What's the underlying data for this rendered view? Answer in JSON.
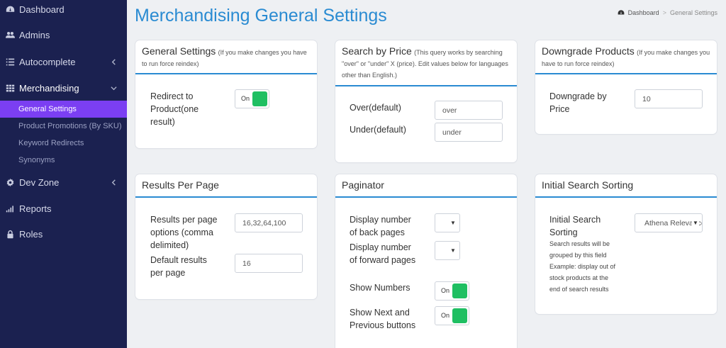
{
  "sidebar": {
    "items": [
      {
        "label": "Dashboard",
        "icon": "dashboard-icon"
      },
      {
        "label": "Admins",
        "icon": "users-icon"
      },
      {
        "label": "Autocomplete",
        "icon": "list-icon"
      },
      {
        "label": "Merchandising",
        "icon": "grid-icon"
      },
      {
        "label": "Dev Zone",
        "icon": "gear-icon"
      },
      {
        "label": "Reports",
        "icon": "bar-chart-icon"
      },
      {
        "label": "Roles",
        "icon": "lock-icon"
      }
    ],
    "sub_items": [
      {
        "label": "General Settings"
      },
      {
        "label": "Product Promotions (By SKU)"
      },
      {
        "label": "Keyword Redirects"
      },
      {
        "label": "Synonyms"
      }
    ]
  },
  "header": {
    "title": "Merchandising General Settings",
    "breadcrumb": {
      "home": "Dashboard",
      "separator": ">",
      "current": "General Settings"
    }
  },
  "cards": {
    "general": {
      "title": "General Settings",
      "note": "(If you make changes you have to run force reindex)",
      "redirect_label": "Redirect to Product(one result)",
      "redirect_toggle": "On"
    },
    "search_price": {
      "title": "Search by Price",
      "note": "(This query works by searching \"over\" or \"under\" X (price). Edit values below for languages other than English.)",
      "over_label": "Over(default)",
      "over_value": "over",
      "under_label": "Under(default)",
      "under_value": "under"
    },
    "downgrade": {
      "title": "Downgrade Products",
      "note": "(If you make changes you have to run force reindex)",
      "price_label": "Downgrade by Price",
      "price_value": "10"
    },
    "results": {
      "title": "Results Per Page",
      "options_label": "Results per page options (comma delimited)",
      "options_value": "16,32,64,100",
      "default_label": "Default results per page",
      "default_value": "16"
    },
    "paginator": {
      "title": "Paginator",
      "back_label": "Display number of back pages",
      "forward_label": "Display number of forward pages",
      "numbers_label": "Show Numbers",
      "numbers_toggle": "On",
      "nextprev_label": "Show Next and Previous buttons",
      "nextprev_toggle": "On"
    },
    "sorting": {
      "title": "Initial Search Sorting",
      "label": "Initial Search Sorting",
      "value": "Athena Relevance",
      "help": "Search results will be grouped by this field Example: display out of stock products at the end of search results"
    }
  },
  "colors": {
    "sidebar_bg": "#1b2150",
    "active_item": "#7b3ff2",
    "accent": "#2a8bd2",
    "toggle_on": "#1fbf62"
  }
}
